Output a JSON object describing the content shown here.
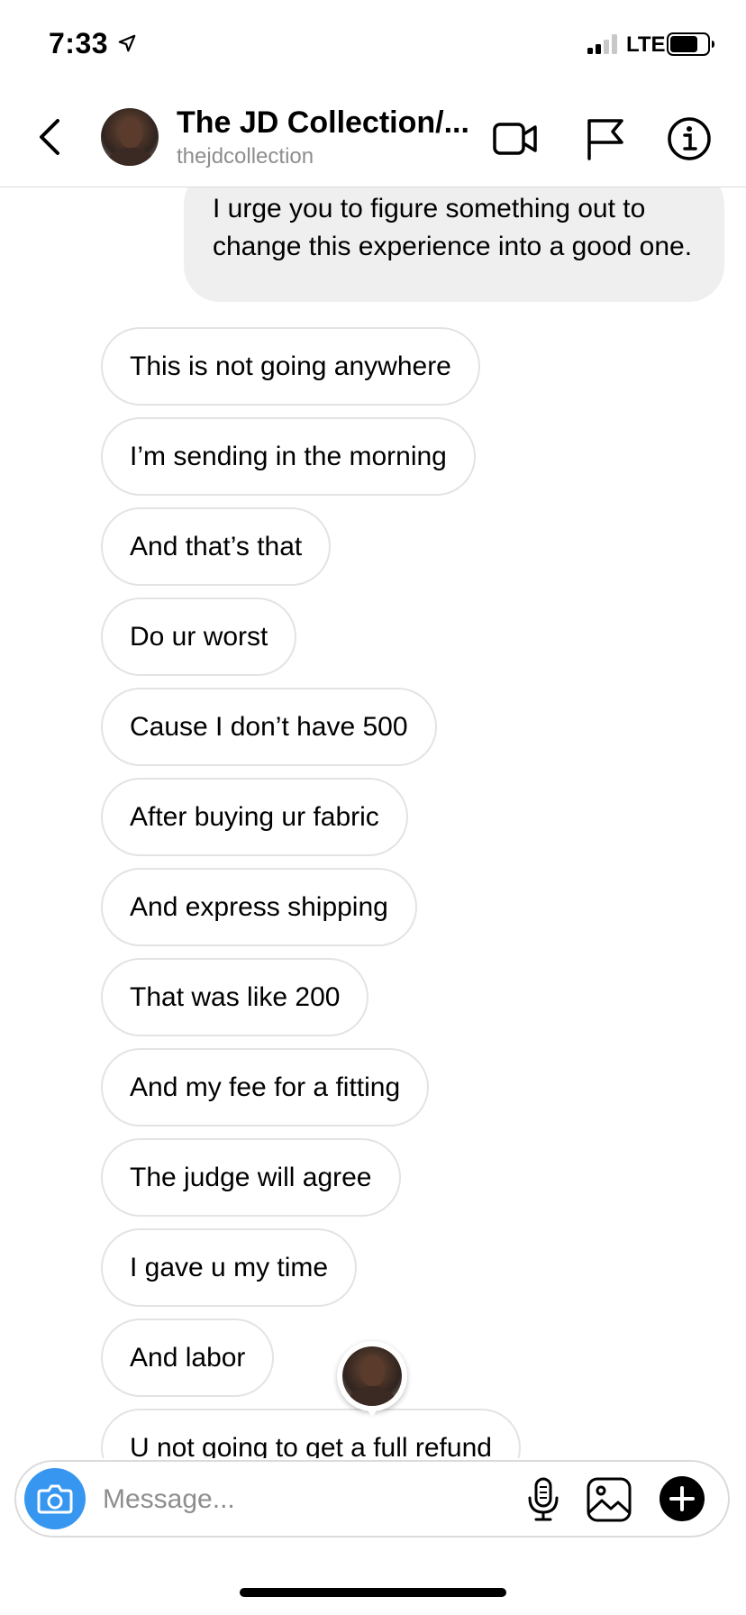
{
  "status_bar": {
    "time": "7:33",
    "network": "LTE"
  },
  "header": {
    "title": "The JD Collection/...",
    "username": "thejdcollection",
    "icons": [
      "back-chevron-icon",
      "video-call-icon",
      "flag-icon",
      "info-icon"
    ]
  },
  "messages": {
    "sent_partial": "I urge you to figure something out to change this experience into a good one.",
    "received": [
      "This is not going anywhere",
      "I’m sending in the morning",
      "And that’s that",
      "Do ur worst",
      "Cause I don’t have 500",
      "After buying ur fabric",
      "And express shipping",
      "That was like 200",
      "And my fee for a fitting",
      "The judge will agree",
      "I gave u my time",
      "And labor",
      "U not going to get a full refund"
    ]
  },
  "composer": {
    "placeholder": "Message...",
    "accent_color": "#3797f0"
  },
  "colors": {
    "sent_bubble": "#efefef",
    "received_border": "#e3e3e3",
    "secondary_text": "#8e8e8e"
  }
}
